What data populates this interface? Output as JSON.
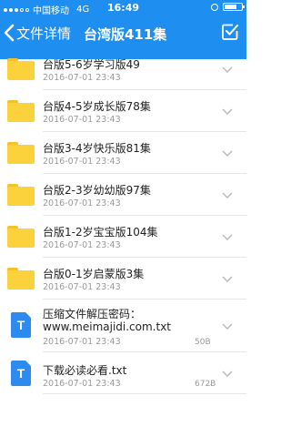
{
  "statusbar": {
    "carrier": "中国移动",
    "network": "4G",
    "time": "16:49"
  },
  "navbar": {
    "back_label": "文件详情",
    "title": "台湾版411集"
  },
  "files": [
    {
      "name": "台版5-6岁学习版49",
      "date": "2016-07-01 23:43",
      "size": "",
      "type": "folder"
    },
    {
      "name": "台版4-5岁成长版78集",
      "date": "2016-07-01 23:43",
      "size": "",
      "type": "folder"
    },
    {
      "name": "台版3-4岁快乐版81集",
      "date": "2016-07-01 23:43",
      "size": "",
      "type": "folder"
    },
    {
      "name": "台版2-3岁幼幼版97集",
      "date": "2016-07-01 23:43",
      "size": "",
      "type": "folder"
    },
    {
      "name": "台版1-2岁宝宝版104集",
      "date": "2016-07-01 23:43",
      "size": "",
      "type": "folder"
    },
    {
      "name": "台版0-1岁启蒙版3集",
      "date": "2016-07-01 23:43",
      "size": "",
      "type": "folder"
    },
    {
      "name": "压缩文件解压密码：",
      "name2": "www.meimajidi.com.txt",
      "date": "2016-07-01 23:43",
      "size": "50B",
      "type": "text-file"
    },
    {
      "name": "下载必读必看.txt",
      "date": "2016-07-01 23:43",
      "size": "672B",
      "type": "text-file"
    }
  ],
  "colors": {
    "header": "#1e8ff0",
    "folder": "#fbd13c",
    "doc": "#2d8bf0"
  },
  "icons": [
    "back-chevron-icon",
    "select-check-icon",
    "folder-icon",
    "text-file-icon",
    "chevron-down-icon"
  ]
}
